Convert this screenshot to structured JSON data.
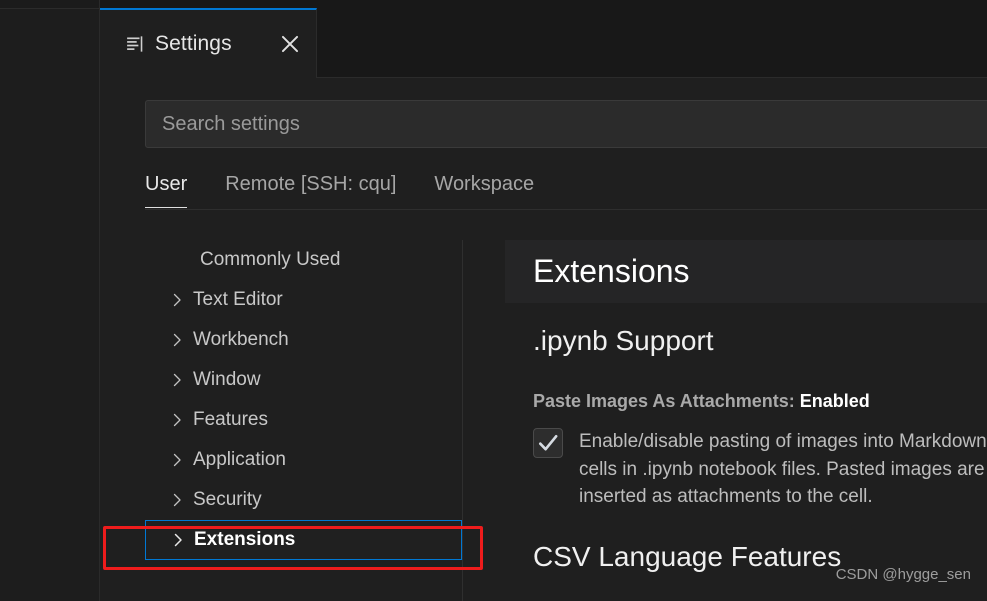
{
  "window": {
    "tab": {
      "icon": "settings-sliders-icon",
      "label": "Settings",
      "close_icon": "close-icon",
      "active_border_color": "#0078d4"
    }
  },
  "search": {
    "placeholder": "Search settings",
    "value": ""
  },
  "scope_tabs": [
    {
      "label": "User",
      "active": true
    },
    {
      "label": "Remote [SSH: cqu]",
      "active": false
    },
    {
      "label": "Workspace",
      "active": false
    }
  ],
  "toc": {
    "items": [
      {
        "label": "Commonly Used",
        "expandable": false,
        "selected": false
      },
      {
        "label": "Text Editor",
        "expandable": true,
        "selected": false
      },
      {
        "label": "Workbench",
        "expandable": true,
        "selected": false
      },
      {
        "label": "Window",
        "expandable": true,
        "selected": false
      },
      {
        "label": "Features",
        "expandable": true,
        "selected": false
      },
      {
        "label": "Application",
        "expandable": true,
        "selected": false
      },
      {
        "label": "Security",
        "expandable": true,
        "selected": false
      },
      {
        "label": "Extensions",
        "expandable": true,
        "selected": true
      }
    ]
  },
  "content": {
    "section_header": "Extensions",
    "group_title": ".ipynb Support",
    "setting": {
      "title_label": "Paste Images As Attachments:",
      "title_value": "Enabled",
      "checkbox_checked": true,
      "checkbox_icon": "checkmark-icon",
      "description": "Enable/disable pasting of images into Markdown cells in .ipynb notebook files. Pasted images are inserted as attachments to the cell."
    },
    "next_group_title": "CSV Language Features"
  },
  "watermark": "CSDN @hygge_sen",
  "colors": {
    "accent": "#0078d4",
    "annotation": "#ee1c1c",
    "editor_background": "#1f1f1f",
    "tabbar_background": "#181818",
    "section_header_background": "#252526"
  }
}
